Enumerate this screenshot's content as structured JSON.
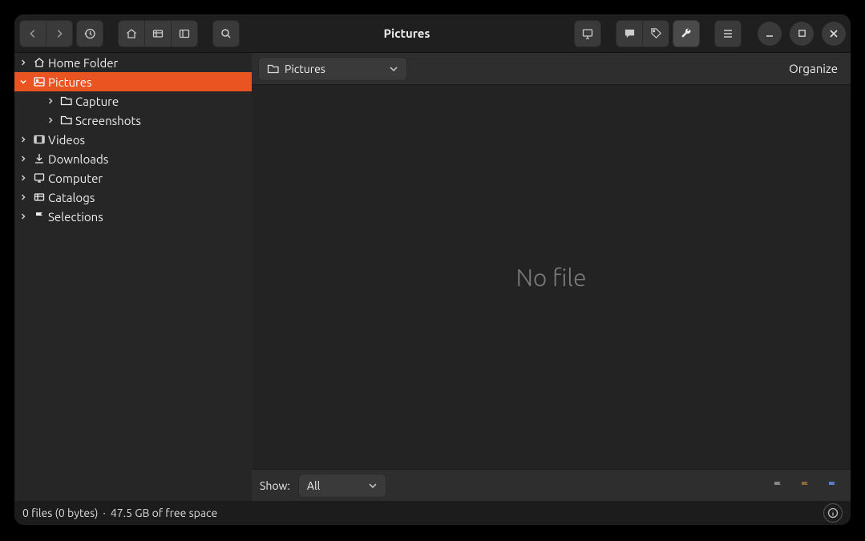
{
  "window_title": "Pictures",
  "sidebar": {
    "items": [
      {
        "label": "Home Folder",
        "icon": "home",
        "arrow": "right",
        "indent": 0,
        "selected": false
      },
      {
        "label": "Pictures",
        "icon": "image",
        "arrow": "down",
        "indent": 0,
        "selected": true
      },
      {
        "label": "Capture",
        "icon": "folder",
        "arrow": "right",
        "indent": 2,
        "selected": false
      },
      {
        "label": "Screenshots",
        "icon": "folder",
        "arrow": "right",
        "indent": 2,
        "selected": false
      },
      {
        "label": "Videos",
        "icon": "video",
        "arrow": "right",
        "indent": 0,
        "selected": false
      },
      {
        "label": "Downloads",
        "icon": "download",
        "arrow": "right",
        "indent": 0,
        "selected": false
      },
      {
        "label": "Computer",
        "icon": "computer",
        "arrow": "right",
        "indent": 0,
        "selected": false
      },
      {
        "label": "Catalogs",
        "icon": "catalog",
        "arrow": "right",
        "indent": 0,
        "selected": false
      },
      {
        "label": "Selections",
        "icon": "flag",
        "arrow": "right",
        "indent": 0,
        "selected": false
      }
    ]
  },
  "location": {
    "label": "Pictures"
  },
  "organize_label": "Organize",
  "empty_message": "No file",
  "filter": {
    "label": "Show:",
    "value": "All"
  },
  "status": {
    "files": "0 files (0 bytes)",
    "free": "47.5 GB of free space",
    "separator": "·"
  }
}
